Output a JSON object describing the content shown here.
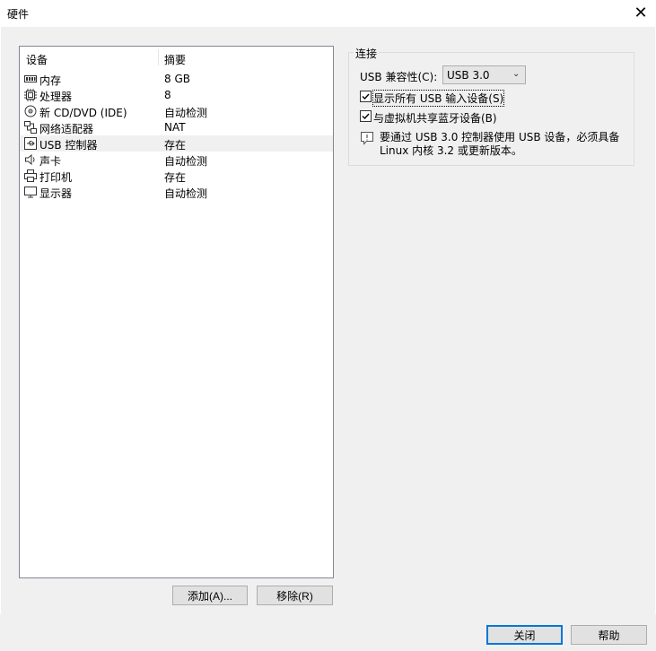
{
  "window": {
    "title": "硬件",
    "close_icon": "close-icon"
  },
  "device_list": {
    "headers": {
      "device": "设备",
      "summary": "摘要"
    },
    "items": [
      {
        "name": "内存",
        "summary": "8 GB",
        "icon": "memory-icon"
      },
      {
        "name": "处理器",
        "summary": "8",
        "icon": "processor-icon"
      },
      {
        "name": "新 CD/DVD (IDE)",
        "summary": "自动检测",
        "icon": "cd-dvd-icon"
      },
      {
        "name": "网络适配器",
        "summary": "NAT",
        "icon": "network-adapter-icon"
      },
      {
        "name": "USB 控制器",
        "summary": "存在",
        "icon": "usb-controller-icon",
        "selected": true
      },
      {
        "name": "声卡",
        "summary": "自动检测",
        "icon": "sound-card-icon"
      },
      {
        "name": "打印机",
        "summary": "存在",
        "icon": "printer-icon"
      },
      {
        "name": "显示器",
        "summary": "自动检测",
        "icon": "display-icon"
      }
    ]
  },
  "buttons": {
    "add": "添加(A)...",
    "remove": "移除(R)",
    "close": "关闭",
    "help": "帮助"
  },
  "connection": {
    "group_title": "连接",
    "compat_label": "USB 兼容性(C):",
    "compat_value": "USB 3.0",
    "show_all_usb": {
      "label": "显示所有 USB 输入设备(S)",
      "checked": true
    },
    "share_bluetooth": {
      "label": "与虚拟机共享蓝牙设备(B)",
      "checked": true
    },
    "info_text": "要通过 USB 3.0 控制器使用 USB 设备，必须具备 Linux 内核 3.2 或更新版本。"
  }
}
